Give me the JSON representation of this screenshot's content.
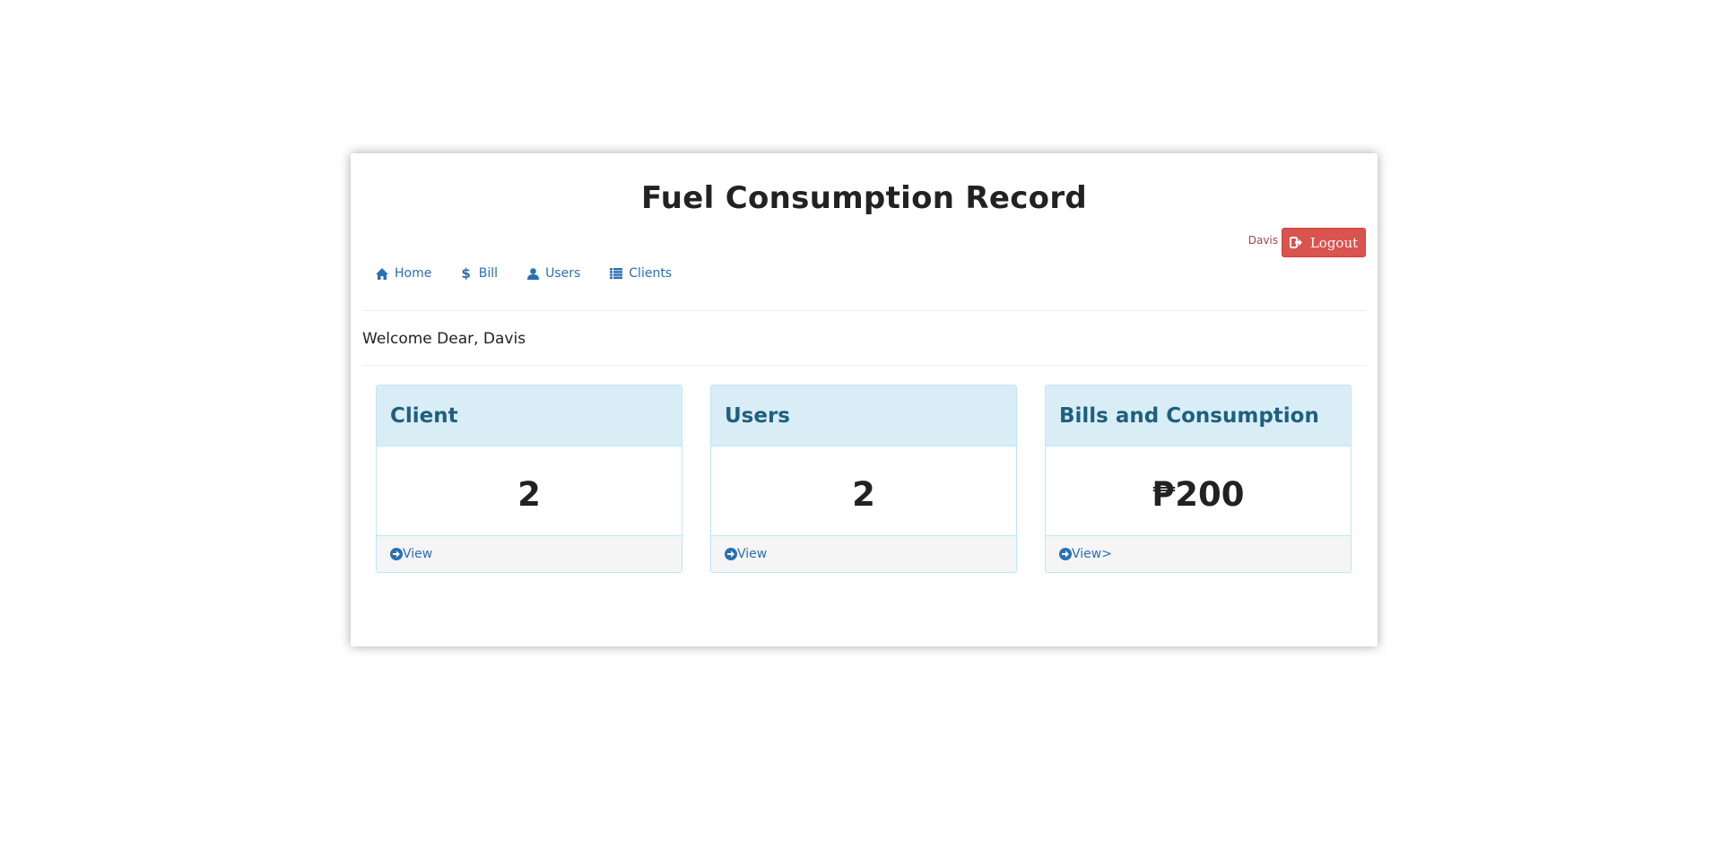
{
  "app": {
    "title": "Fuel Consumption Record"
  },
  "user": {
    "name": "Davis",
    "logout_label": "Logout"
  },
  "nav": {
    "items": [
      {
        "label": "Home",
        "icon": "home-icon"
      },
      {
        "label": "Bill",
        "icon": "dollar-icon"
      },
      {
        "label": "Users",
        "icon": "user-icon"
      },
      {
        "label": "Clients",
        "icon": "list-icon"
      }
    ]
  },
  "welcome": "Welcome Dear, Davis",
  "panels": [
    {
      "title": "Client",
      "value": "2",
      "link": "View"
    },
    {
      "title": "Users",
      "value": "2",
      "link": "View"
    },
    {
      "title": "Bills and Consumption",
      "value": "₱200",
      "link": "View>"
    }
  ],
  "colors": {
    "accent": "#2a6fb4",
    "danger": "#d9534f",
    "panel_heading_bg": "#d9edf7",
    "panel_heading_text": "#1f5f7f"
  }
}
